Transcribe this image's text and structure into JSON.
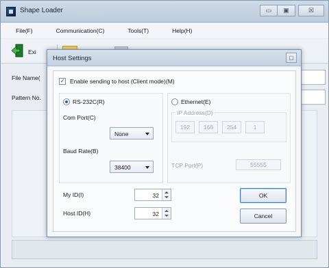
{
  "window": {
    "title": "Shape Loader",
    "controls": {
      "minimize": "▭",
      "maximize": "▣",
      "close": "☒"
    }
  },
  "menu": [
    "File(F)",
    "Communication(C)",
    "Tools(T)",
    "Help(H)"
  ],
  "toolbar": {
    "exit_label": "Exi"
  },
  "fields": {
    "file_name_label": "File Name(",
    "pattern_no_label": "Pattern No."
  },
  "dialog": {
    "title": "Host Settings",
    "close_glyph": "▢",
    "enable_sending": {
      "label": "Enable sending to host (Client mode)(M)",
      "checked": true
    },
    "rs232c": {
      "label": "RS-232C(R)",
      "selected": true,
      "com_port_label": "Com Port(C)",
      "com_port_value": "None",
      "baud_rate_label": "Baud Rate(B)",
      "baud_rate_value": "38400"
    },
    "ethernet": {
      "label": "Ethernet(E)",
      "selected": false,
      "ip_label": "IP Address(D)",
      "ip": [
        "192",
        "168",
        "254",
        "1"
      ],
      "tcp_port_label": "TCP Port(P)",
      "tcp_port_value": "55555"
    },
    "my_id": {
      "label": "My ID(I)",
      "value": "32"
    },
    "host_id": {
      "label": "Host ID(H)",
      "value": "32"
    },
    "ok_label": "OK",
    "cancel_label": "Cancel"
  },
  "colors": {
    "accent": "#3c7fd2",
    "titlebar": "#c5d2e2",
    "disabled_text": "#9aa3ae"
  }
}
